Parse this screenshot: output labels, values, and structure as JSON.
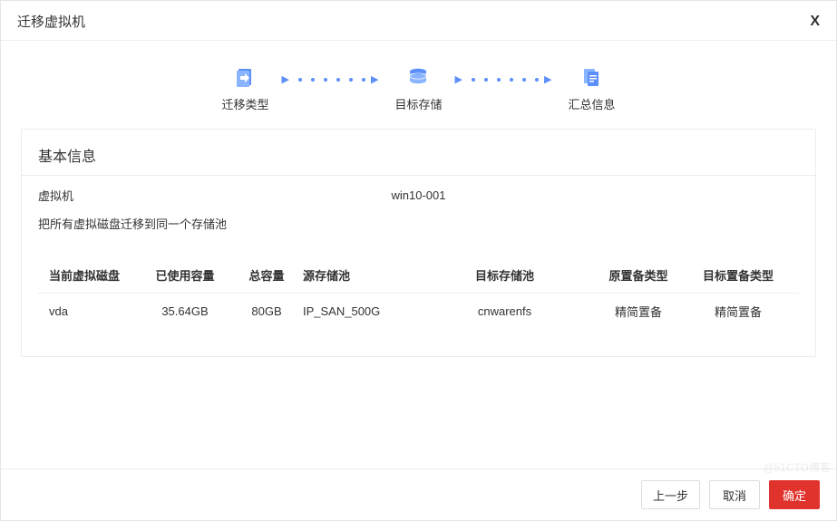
{
  "dialog": {
    "title": "迁移虚拟机",
    "close": "X"
  },
  "steps": {
    "s1": "迁移类型",
    "s2": "目标存储",
    "s3": "汇总信息"
  },
  "panel": {
    "title": "基本信息",
    "vm_label": "虚拟机",
    "vm_name": "win10-001",
    "note": "把所有虚拟磁盘迁移到同一个存储池"
  },
  "table": {
    "headers": {
      "c1": "当前虚拟磁盘",
      "c2": "已使用容量",
      "c3": "总容量",
      "c4": "源存储池",
      "c5": "目标存储池",
      "c6": "原置备类型",
      "c7": "目标置备类型"
    },
    "row0": {
      "c1": "vda",
      "c2": "35.64GB",
      "c3": "80GB",
      "c4": "IP_SAN_500G",
      "c5": "cnwarenfs",
      "c6": "精简置备",
      "c7": "精简置备"
    }
  },
  "footer": {
    "prev": "上一步",
    "cancel": "取消",
    "confirm": "确定"
  },
  "watermark": "@51CTO博客"
}
